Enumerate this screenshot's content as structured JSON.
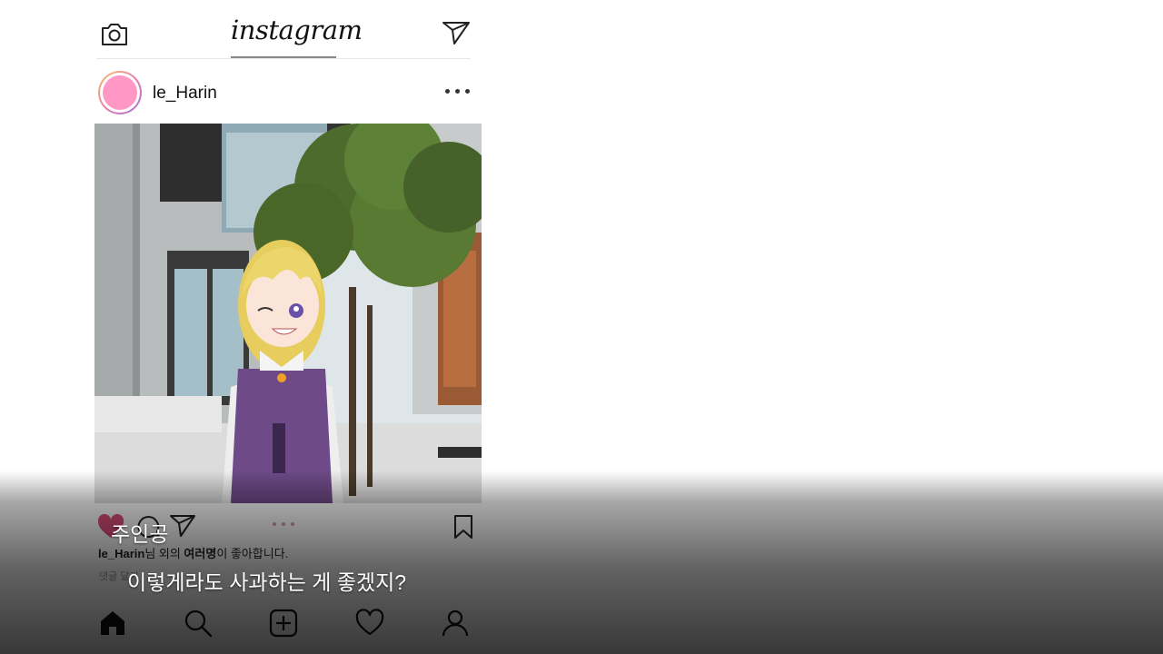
{
  "app": {
    "logo_text": "instagram"
  },
  "post": {
    "username": "le_Harin",
    "likes_user": "le_Harin",
    "likes_mid": "님 외의 ",
    "likes_bold": "여러명",
    "likes_end": "이 좋아합니다.",
    "comments_text": "댓글 달기",
    "liked": true,
    "carousel_count": 3
  },
  "dialogue": {
    "speaker": "주인공",
    "line": "이렇게라도 사과하는 게 좋겠지?"
  },
  "icons": {
    "camera": "camera-icon",
    "direct": "paper-plane-icon",
    "more": "more-dots-icon",
    "like": "heart-icon",
    "comment": "comment-icon",
    "share": "share-icon",
    "save": "bookmark-icon",
    "home": "home-icon",
    "search": "search-icon",
    "add": "add-post-icon",
    "activity": "heart-outline-icon",
    "profile": "profile-icon"
  },
  "colors": {
    "avatar_fill": "#ff98c5",
    "like_active": "#e0507e",
    "dress": "#6e4a88",
    "hair": "#ecd56a",
    "tree": "#4d6b2c"
  }
}
